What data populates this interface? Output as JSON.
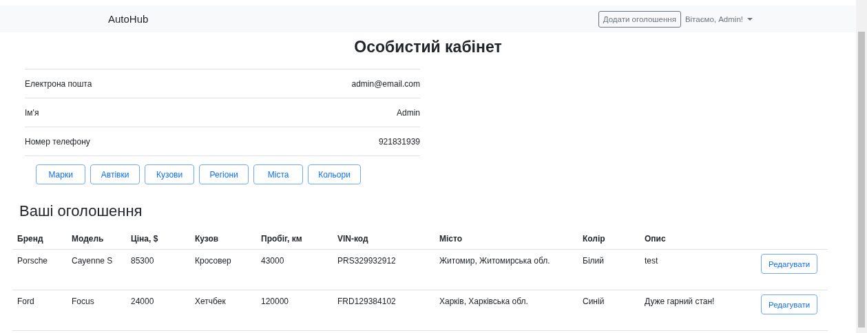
{
  "navbar": {
    "brand": "AutoHub",
    "add_button": "Додати оголошення",
    "user_menu": "Вітаємо, Admin!"
  },
  "title": "Особистий кабінет",
  "profile": [
    {
      "label": "Електрона пошта",
      "value": "admin@email.com"
    },
    {
      "label": "Ім'я",
      "value": "Admin"
    },
    {
      "label": "Номер телефону",
      "value": "921831939"
    }
  ],
  "admin_buttons": [
    "Марки",
    "Автівки",
    "Кузови",
    "Регіони",
    "Міста",
    "Кольори"
  ],
  "listings": {
    "heading": "Ваші оголошення",
    "columns": [
      "Бренд",
      "Модель",
      "Ціна, $",
      "Кузов",
      "Пробіг, км",
      "VIN-код",
      "Місто",
      "Колір",
      "Опис"
    ],
    "rows": [
      {
        "cells": [
          "Porsche",
          "Cayenne S",
          "85300",
          "Кросовер",
          "43000",
          "PRS329932912",
          "Житомир, Житомирська обл.",
          "Білий",
          "test"
        ],
        "action": "Редагувати"
      },
      {
        "cells": [
          "Ford",
          "Focus",
          "24000",
          "Хетчбек",
          "120000",
          "FRD129384102",
          "Харків, Харківська обл.",
          "Синій",
          "Дуже гарний стан!"
        ],
        "action": "Редагувати"
      }
    ]
  }
}
